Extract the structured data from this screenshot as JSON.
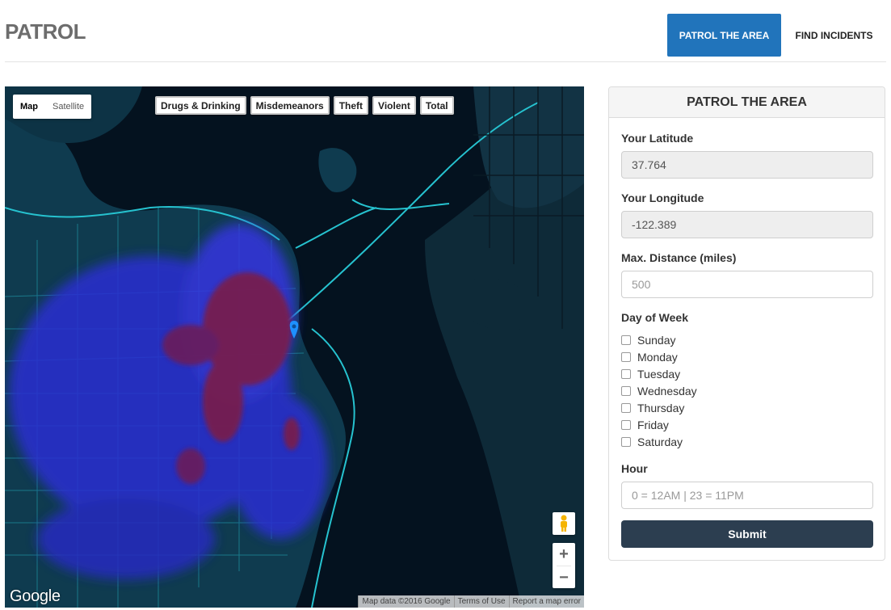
{
  "header": {
    "brand": "PATROL",
    "nav": [
      {
        "label": "PATROL THE AREA",
        "active": true
      },
      {
        "label": "FIND INCIDENTS",
        "active": false
      }
    ]
  },
  "map": {
    "type_controls": {
      "map": "Map",
      "satellite": "Satellite",
      "selected": "Map"
    },
    "filters": [
      "Drugs & Drinking",
      "Misdemeanors",
      "Theft",
      "Violent",
      "Total"
    ],
    "zoom_in": "+",
    "zoom_out": "−",
    "logo": "Google",
    "attribution": [
      "Map data ©2016 Google",
      "Terms of Use",
      "Report a map error"
    ],
    "colors": {
      "water": "#04121f",
      "land": "#0f3b4f",
      "road": "#1fa5b5",
      "heat_low": "#2c2fd2",
      "heat_high": "#7a1a4a",
      "pin": "#1e90ff"
    }
  },
  "panel": {
    "title": "PATROL THE AREA",
    "latitude": {
      "label": "Your Latitude",
      "value": "37.764"
    },
    "longitude": {
      "label": "Your Longitude",
      "value": "-122.389"
    },
    "distance": {
      "label": "Max. Distance (miles)",
      "placeholder": "500"
    },
    "day_of_week": {
      "label": "Day of Week",
      "days": [
        "Sunday",
        "Monday",
        "Tuesday",
        "Wednesday",
        "Thursday",
        "Friday",
        "Saturday"
      ]
    },
    "hour": {
      "label": "Hour",
      "placeholder": "0 = 12AM | 23 = 11PM"
    },
    "submit": "Submit",
    "accent": "#2174bb",
    "submit_color": "#2c3e50"
  }
}
